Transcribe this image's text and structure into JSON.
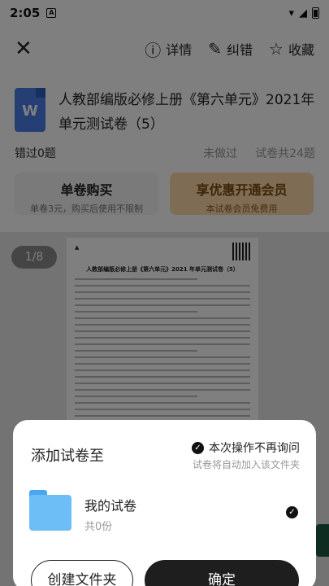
{
  "status": {
    "time": "2:05"
  },
  "topbar": {
    "details": "详情",
    "report_error": "纠错",
    "favorite": "收藏"
  },
  "document": {
    "icon_letter": "W",
    "title": "人教部编版必修上册《第六单元》2021年单元测试卷（5）",
    "wrong_count": "错过0题",
    "not_done": "未做过",
    "total": "试卷共24题"
  },
  "purchase": {
    "single_title": "单卷购买",
    "single_sub": "单卷3元，购买后使用不限制",
    "vip_title": "享优惠开通会员",
    "vip_sub": "本试卷会员免费用"
  },
  "preview": {
    "page_indicator": "1/8",
    "paper_title": "人教部编版必修上册《第六单元》2021 年单元测试卷（5）"
  },
  "sheet": {
    "title": "添加试卷至",
    "no_ask": "本次操作不再询问",
    "auto_add_hint": "试卷将自动加入该文件夹",
    "folder_name": "我的试卷",
    "folder_count": "共0份",
    "create_folder": "创建文件夹",
    "confirm": "确定"
  }
}
